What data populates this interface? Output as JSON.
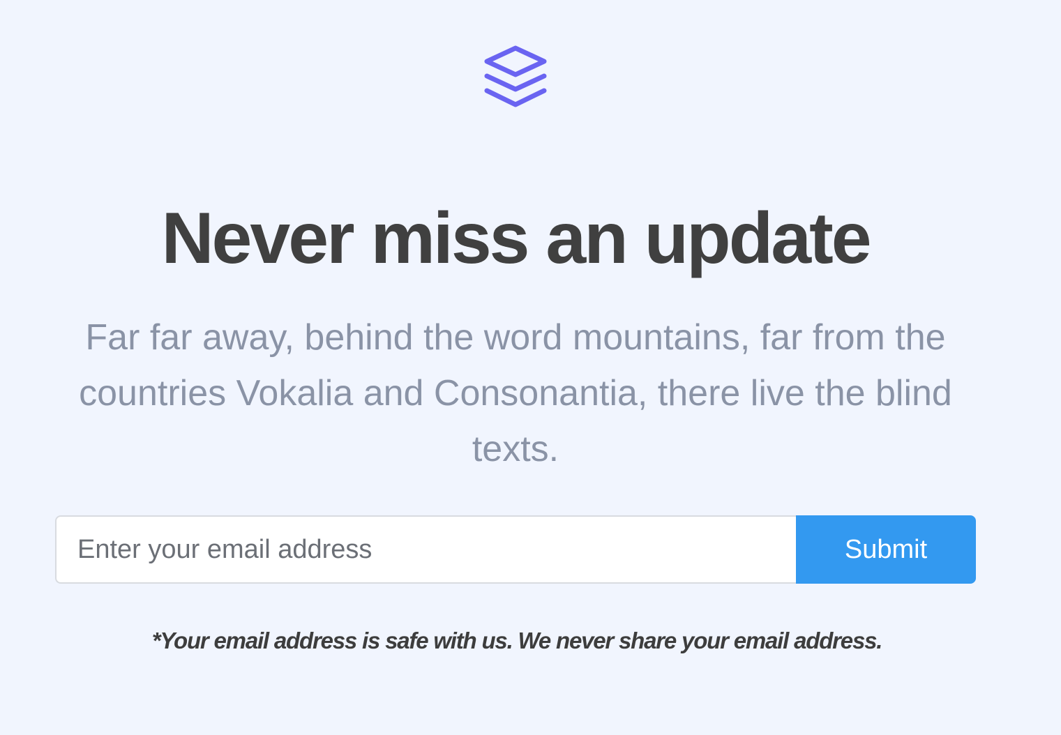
{
  "logo": {
    "icon": "layers-icon",
    "color": "#6a64f1"
  },
  "headline": "Never miss an update",
  "subtext": "Far far away, behind the word mountains, far from the countries Vokalia and Consonantia, there live the blind texts.",
  "form": {
    "email_placeholder": "Enter your email address",
    "email_value": "",
    "submit_label": "Submit",
    "accent_color": "#3399f0"
  },
  "disclaimer": "*Your email address is safe with us. We never share your email address."
}
